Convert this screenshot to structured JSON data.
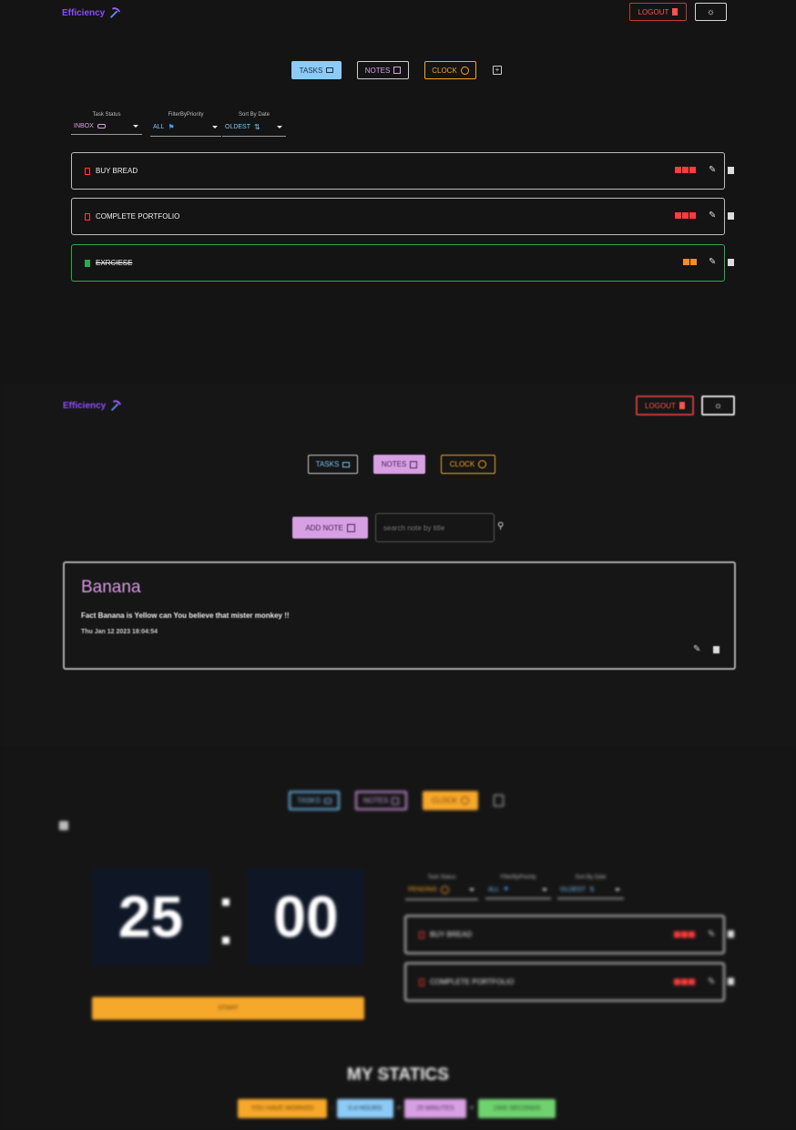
{
  "brand": {
    "name": "Efficiency",
    "icon": "pickaxe-icon"
  },
  "header": {
    "logout_label": "LOGOUT",
    "theme_icon": "sun-icon"
  },
  "nav": {
    "tasks": "TASKS",
    "notes": "NOTES",
    "clock": "CLOCK"
  },
  "tasks_view": {
    "filters": [
      {
        "label": "Task Status",
        "value": "INBOX",
        "icon": "inbox-icon"
      },
      {
        "label": "FilterByPriority",
        "value": "ALL",
        "icon": "flag-icon"
      },
      {
        "label": "Sort By Date",
        "value": "OLDEST",
        "icon": "sort-icon"
      }
    ],
    "tasks": [
      {
        "title": "BUY BREAD",
        "priority": 3,
        "done": false,
        "flag_color": "#ff3b3b"
      },
      {
        "title": "COMPLETE PORTFOLIO",
        "priority": 3,
        "done": false,
        "flag_color": "#ff3b3b"
      },
      {
        "title": "EXRCIESE",
        "priority": 2,
        "done": true,
        "flag_color": "#ff8a1f"
      }
    ]
  },
  "notes_view": {
    "add_note_label": "ADD NOTE",
    "search_placeholder": "search note by title",
    "notes": [
      {
        "title": "Banana",
        "body": "Fact Banana is Yellow can You believe that mister monkey !!",
        "date": "Thu Jan 12 2023 18:04:54"
      }
    ]
  },
  "clock_view": {
    "minutes": "25",
    "separator": ":",
    "seconds": "00",
    "start_label": "START",
    "filters": [
      {
        "label": "Task Status",
        "value": "PENDING",
        "icon": "clock-icon"
      },
      {
        "label": "FilterByPriority",
        "value": "ALL",
        "icon": "flag-icon"
      },
      {
        "label": "Sort By Date",
        "value": "OLDEST",
        "icon": "sort-icon"
      }
    ],
    "tasks": [
      {
        "title": "BUY BREAD",
        "priority": 3
      },
      {
        "title": "COMPLETE PORTFOLIO",
        "priority": 3
      }
    ]
  },
  "stats": {
    "title": "MY STATICS",
    "worked_label": "YOU HAVE WORKED",
    "hours": "0.4 HOURS",
    "minutes": "25 MINUTES",
    "seconds": "1500 SECONDS",
    "sep1": ":",
    "sep2": "=",
    "sep3": "="
  },
  "colors": {
    "brand": "#8a4dff",
    "tasks_accent": "#8ccbf7",
    "notes_accent": "#d7a0e3",
    "clock_accent": "#f6a82b",
    "danger": "#ff3b3b",
    "success": "#2fa84f"
  }
}
